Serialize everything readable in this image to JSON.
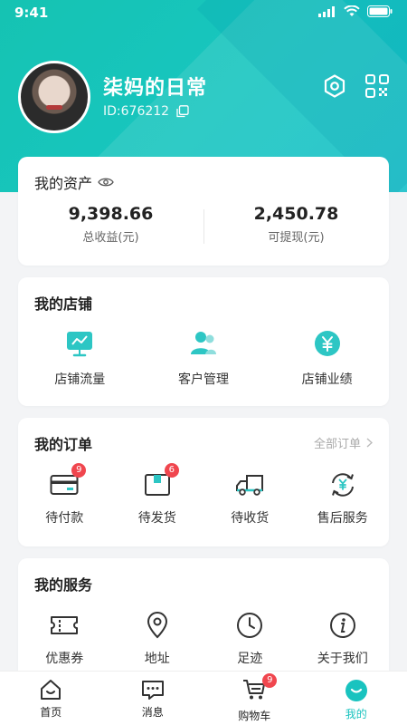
{
  "status_bar": {
    "time": "9:41"
  },
  "profile": {
    "name": "柒妈的日常",
    "id_text": "ID:676212"
  },
  "assets": {
    "title": "我的资产",
    "items": [
      {
        "value": "9,398.66",
        "label": "总收益(元)"
      },
      {
        "value": "2,450.78",
        "label": "可提现(元)"
      }
    ]
  },
  "shop": {
    "title": "我的店铺",
    "items": [
      {
        "label": "店铺流量",
        "icon": "chart-icon"
      },
      {
        "label": "客户管理",
        "icon": "users-icon"
      },
      {
        "label": "店铺业绩",
        "icon": "yen-icon"
      }
    ]
  },
  "orders": {
    "title": "我的订单",
    "see_all": "全部订单",
    "items": [
      {
        "label": "待付款",
        "icon": "card-icon",
        "badge": "9"
      },
      {
        "label": "待发货",
        "icon": "box-icon",
        "badge": "6"
      },
      {
        "label": "待收货",
        "icon": "truck-icon",
        "badge": ""
      },
      {
        "label": "售后服务",
        "icon": "refund-icon",
        "badge": ""
      }
    ]
  },
  "services": {
    "title": "我的服务",
    "items": [
      {
        "label": "优惠券",
        "icon": "coupon-icon"
      },
      {
        "label": "地址",
        "icon": "location-icon"
      },
      {
        "label": "足迹",
        "icon": "clock-icon"
      },
      {
        "label": "关于我们",
        "icon": "info-icon"
      }
    ]
  },
  "tabbar": {
    "items": [
      {
        "label": "首页",
        "icon": "home-icon"
      },
      {
        "label": "消息",
        "icon": "message-icon"
      },
      {
        "label": "购物车",
        "icon": "cart-icon",
        "badge": "9"
      },
      {
        "label": "我的",
        "icon": "profile-icon"
      }
    ],
    "active": "我的"
  },
  "colors": {
    "accent": "#19c3bf",
    "badge": "#f0464e",
    "header": "#15c3b2"
  }
}
